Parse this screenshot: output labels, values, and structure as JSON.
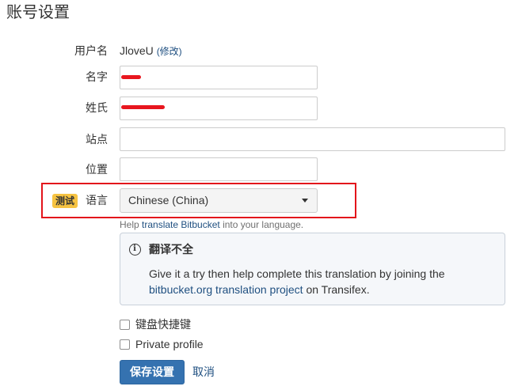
{
  "page": {
    "title": "账号设置"
  },
  "form": {
    "username": {
      "label": "用户名",
      "value": "JloveU",
      "change_link": "(修改)"
    },
    "first_name": {
      "label": "名字"
    },
    "last_name": {
      "label": "姓氏"
    },
    "website": {
      "label": "站点"
    },
    "location": {
      "label": "位置"
    },
    "language": {
      "badge": "测试",
      "label": "语言",
      "selected": "Chinese (China)"
    },
    "help": {
      "prefix": "Help ",
      "link": "translate Bitbucket",
      "suffix": " into your language."
    }
  },
  "notice": {
    "heading": "翻译不全",
    "text_before": "Give it a try then help complete this translation by joining the",
    "link": "bitbucket.org translation project",
    "text_after": " on Transifex."
  },
  "checkboxes": [
    {
      "label": "键盘快捷键",
      "checked": false
    },
    {
      "label": "Private profile",
      "checked": false
    }
  ],
  "actions": {
    "save": "保存设置",
    "cancel": "取消"
  },
  "colors": {
    "link": "#205081",
    "button": "#3572b0",
    "highlight": "#e3141b",
    "badge": "#f6c342",
    "redaction": "#e8161e"
  },
  "icons": {
    "info": "info-icon",
    "select_caret": "chevron-down-icon"
  }
}
